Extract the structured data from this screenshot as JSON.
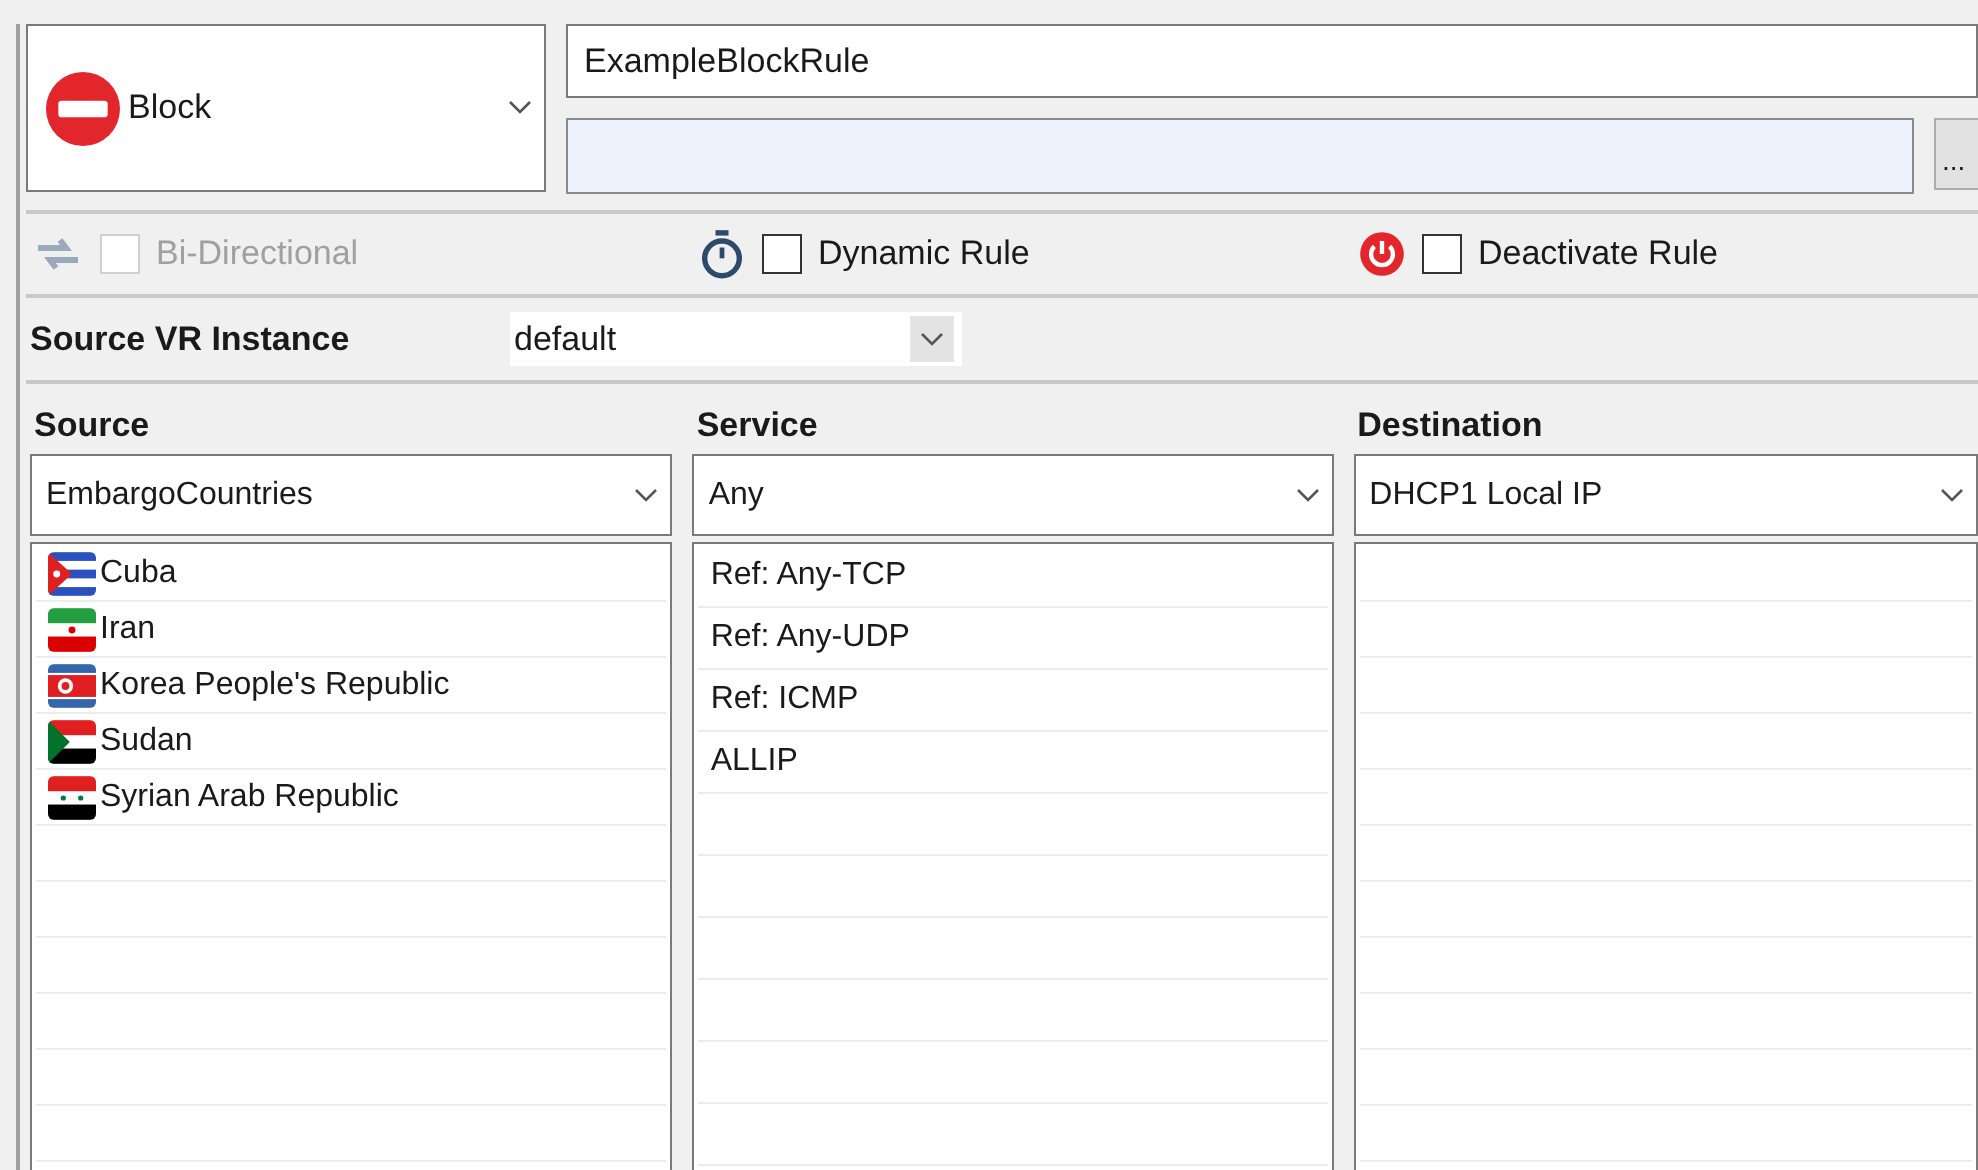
{
  "action": {
    "label": "Block",
    "kind": "block"
  },
  "rule_name": {
    "value": "ExampleBlockRule"
  },
  "description": {
    "browse_button": "..."
  },
  "options": [
    {
      "kind": "bidirectional",
      "label": "Bi-Directional",
      "checked": false,
      "disabled": true
    },
    {
      "kind": "dynamic",
      "label": "Dynamic Rule",
      "checked": false,
      "disabled": false
    },
    {
      "kind": "deactivate",
      "label": "Deactivate Rule",
      "checked": false,
      "disabled": false
    }
  ],
  "source_vr_instance": {
    "label": "Source VR Instance",
    "value": "default"
  },
  "columns": [
    {
      "title": "Source",
      "value": "EmbargoCountries",
      "items": [
        {
          "label": "Cuba"
        },
        {
          "label": "Iran"
        },
        {
          "label": "Korea People's Republic"
        },
        {
          "label": "Sudan"
        },
        {
          "label": "Syrian Arab Republic"
        }
      ]
    },
    {
      "title": "Service",
      "value": "Any",
      "items": [
        {
          "label": "Ref: Any-TCP"
        },
        {
          "label": "Ref: Any-UDP"
        },
        {
          "label": "Ref: ICMP"
        },
        {
          "label": "ALLIP"
        }
      ]
    },
    {
      "title": "Destination",
      "value": "DHCP1 Local IP"
    }
  ]
}
